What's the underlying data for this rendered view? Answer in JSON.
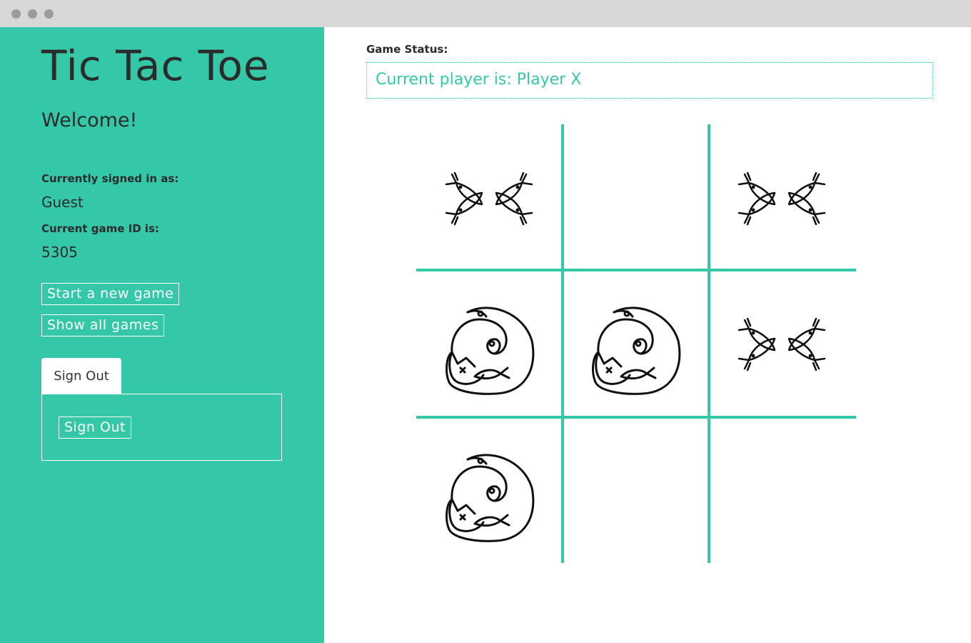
{
  "sidebar": {
    "title": "Tic Tac Toe",
    "welcome": "Welcome!",
    "signed_in_label": "Currently signed in as:",
    "user": "Guest",
    "game_id_label": "Current game ID is:",
    "game_id": "5305",
    "new_game_label": "Start a new game",
    "show_games_label": "Show all games",
    "tab_label": "Sign Out",
    "sign_out_label": "Sign Out"
  },
  "status": {
    "label": "Game Status:",
    "text": "Current player is: Player X"
  },
  "board": {
    "cells": [
      "fish",
      "",
      "fish",
      "cat",
      "cat",
      "fish",
      "cat",
      "",
      ""
    ]
  },
  "colors": {
    "accent": "#34c8a9",
    "text": "#2b2b2b"
  },
  "icons": {
    "x_mark": "fish-icon",
    "o_mark": "cat-icon"
  }
}
